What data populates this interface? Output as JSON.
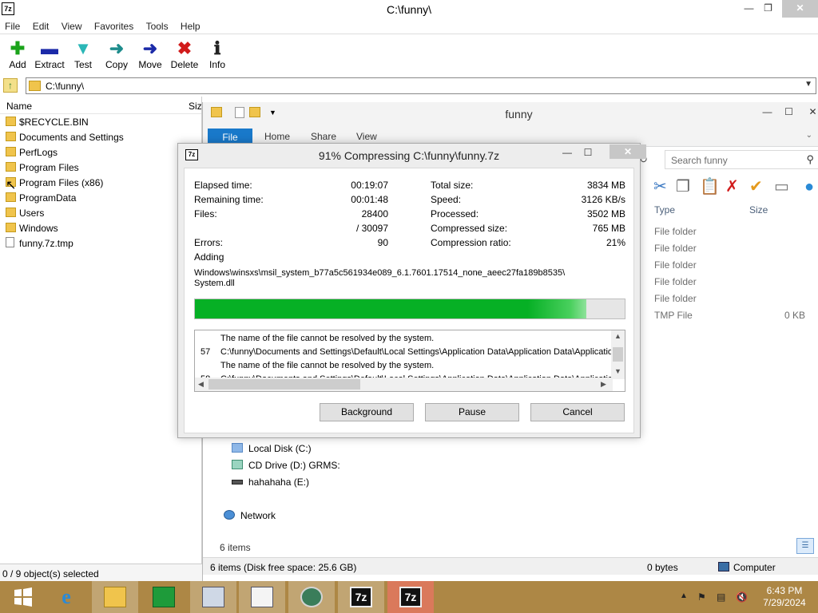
{
  "zip": {
    "app_icon": "7z",
    "title": "C:\\funny\\",
    "menu": [
      "File",
      "Edit",
      "View",
      "Favorites",
      "Tools",
      "Help"
    ],
    "toolbar": [
      {
        "label": "Add",
        "icon": "plus-icon",
        "color": "#1aa31a"
      },
      {
        "label": "Extract",
        "icon": "minus-icon",
        "color": "#1b2aa8"
      },
      {
        "label": "Test",
        "icon": "check-arrows-icon",
        "color": "#2bb7b7"
      },
      {
        "label": "Copy",
        "icon": "arrow-right-icon",
        "color": "#1e8c8c"
      },
      {
        "label": "Move",
        "icon": "arrow-right-icon",
        "color": "#1b2aa8"
      },
      {
        "label": "Delete",
        "icon": "x-icon",
        "color": "#d11b1b"
      },
      {
        "label": "Info",
        "icon": "info-icon",
        "color": "#222222"
      }
    ],
    "path": "C:\\funny\\",
    "columns": {
      "name": "Name",
      "size": "Size"
    },
    "files": [
      {
        "name": "$RECYCLE.BIN",
        "kind": "folder"
      },
      {
        "name": "Documents and Settings",
        "kind": "folder"
      },
      {
        "name": "PerfLogs",
        "kind": "folder"
      },
      {
        "name": "Program Files",
        "kind": "folder"
      },
      {
        "name": "Program Files (x86)",
        "kind": "folder"
      },
      {
        "name": "ProgramData",
        "kind": "folder"
      },
      {
        "name": "Users",
        "kind": "folder"
      },
      {
        "name": "Windows",
        "kind": "folder"
      },
      {
        "name": "funny.7z.tmp",
        "kind": "file"
      }
    ],
    "status": "0 / 9 object(s) selected"
  },
  "explorer": {
    "title": "funny",
    "ribbon_tabs": [
      "File",
      "Home",
      "Share",
      "View"
    ],
    "search_placeholder": "Search funny",
    "columns": {
      "type": "Type",
      "size": "Size"
    },
    "types": [
      {
        "type": "File folder",
        "size": ""
      },
      {
        "type": "File folder",
        "size": ""
      },
      {
        "type": "File folder",
        "size": ""
      },
      {
        "type": "File folder",
        "size": ""
      },
      {
        "type": "File folder",
        "size": ""
      },
      {
        "type": "TMP File",
        "size": "0 KB"
      }
    ],
    "nav": {
      "local_disk": "Local Disk (C:)",
      "cd_drive": "CD Drive (D:) GRMS:",
      "hahaha": "hahahaha (E:)",
      "network": "Network"
    },
    "item_count": "6 items",
    "status_left": "6 items (Disk free space: 25.6 GB)",
    "status_mid": "0 bytes",
    "status_right": "Computer"
  },
  "dialog": {
    "app_icon": "7z",
    "title": "91% Compressing C:\\funny\\funny.7z",
    "progress": 0.91,
    "left_stats": [
      {
        "label": "Elapsed time:",
        "value": "00:19:07"
      },
      {
        "label": "Remaining time:",
        "value": "00:01:48"
      },
      {
        "label": "Files:",
        "value": "28400"
      },
      {
        "label": "",
        "value": "/ 30097"
      },
      {
        "label": "Errors:",
        "value": "90"
      }
    ],
    "right_stats": [
      {
        "label": "Total size:",
        "value": "3834 MB"
      },
      {
        "label": "Speed:",
        "value": "3126 KB/s"
      },
      {
        "label": "Processed:",
        "value": "3502 MB"
      },
      {
        "label": "Compressed size:",
        "value": "765 MB"
      },
      {
        "label": "Compression ratio:",
        "value": "21%"
      }
    ],
    "action": "Adding",
    "current_file_1": "Windows\\winsxs\\msil_system_b77a5c561934e089_6.1.7601.17514_none_aeec27fa189b8535\\",
    "current_file_2": "System.dll",
    "log": [
      {
        "num": "",
        "msg": "The name of the file cannot be resolved by the system."
      },
      {
        "num": "57",
        "msg": "C:\\funny\\Documents and Settings\\Default\\Local Settings\\Application Data\\Application Data\\Application Data"
      },
      {
        "num": "",
        "msg": "The name of the file cannot be resolved by the system."
      },
      {
        "num": "58",
        "msg": "C:\\funny\\Documents and Settings\\Default\\Local Settings\\Application Data\\Application Data\\Applicatio"
      }
    ],
    "buttons": {
      "background": "Background",
      "pause": "Pause",
      "cancel": "Cancel"
    }
  },
  "taskbar": {
    "clock_time": "6:43 PM",
    "clock_date": "7/29/2024",
    "pinned": [
      "windows-start-icon",
      "internet-explorer-icon",
      "file-explorer-icon",
      "store-icon",
      "performance-monitor-icon",
      "document-icon",
      "globe-app-icon",
      "7zip-icon",
      "7zip-icon"
    ],
    "sevenzip_label": "7z"
  }
}
